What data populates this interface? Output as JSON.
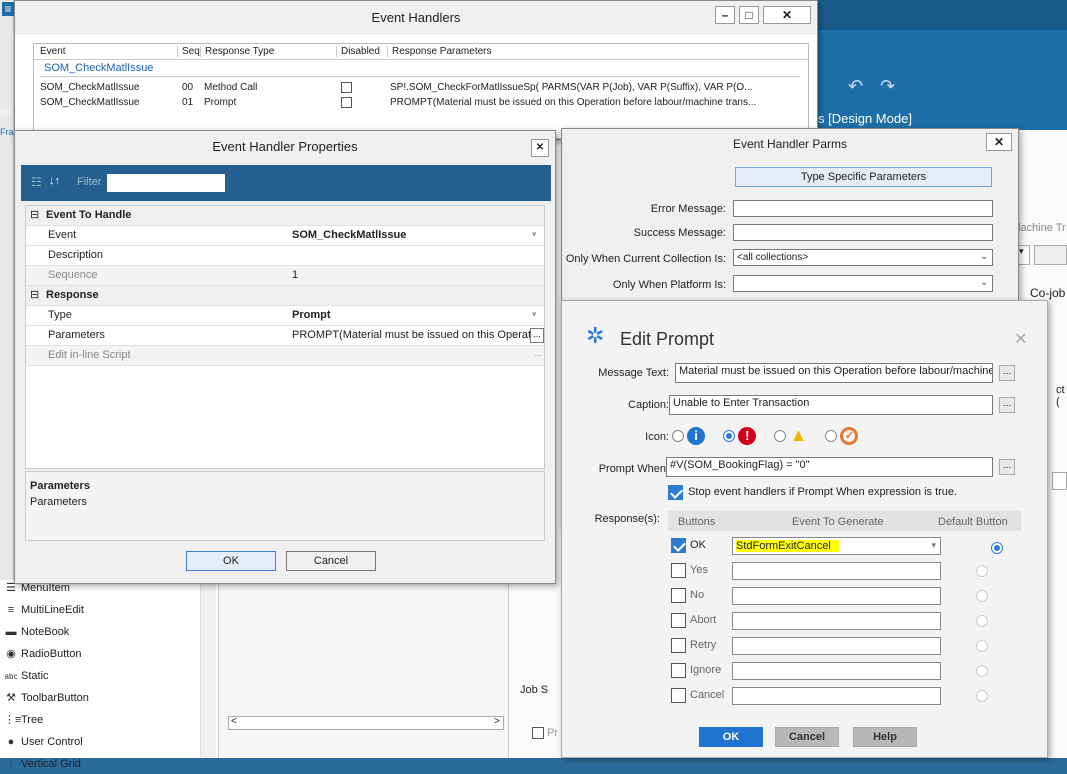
{
  "background": {
    "design_mode_label": "s  [Design Mode]",
    "right_labels": {
      "machine_tr": "lachine Tr",
      "co_job": "Co-job",
      "ct": "ct (",
      "job_s": "Job S",
      "pr": "Pr"
    },
    "toolbox_items": [
      {
        "label": "MenuItem",
        "icon": "menu-icon"
      },
      {
        "label": "MultiLineEdit",
        "icon": "multiline-icon"
      },
      {
        "label": "NoteBook",
        "icon": "notebook-icon"
      },
      {
        "label": "RadioButton",
        "icon": "radio-icon"
      },
      {
        "label": "Static",
        "icon": "abc-icon",
        "prefix": "abc"
      },
      {
        "label": "ToolbarButton",
        "icon": "toolbar-icon"
      },
      {
        "label": "Tree",
        "icon": "tree-icon"
      },
      {
        "label": "User Control",
        "icon": "user-icon"
      },
      {
        "label": "Vertical Grid",
        "icon": "grid-icon"
      }
    ],
    "left_strip_text": "Fra",
    "left_strip_text2": "oo"
  },
  "event_handlers": {
    "title": "Event Handlers",
    "columns": [
      "Event",
      "Seq",
      "Response Type",
      "Disabled",
      "Response Parameters"
    ],
    "group": "SOM_CheckMatlIssue",
    "rows": [
      {
        "event": "SOM_CheckMatlIssue",
        "seq": "00",
        "type": "Method Call",
        "disabled": false,
        "params": "SP!.SOM_CheckForMatlIssueSp( PARMS(VAR P(Job), VAR P(Suffix), VAR P(O..."
      },
      {
        "event": "SOM_CheckMatlIssue",
        "seq": "01",
        "type": "Prompt",
        "disabled": false,
        "params": "PROMPT(Material must be issued on this Operation before labour/machine trans..."
      }
    ]
  },
  "props": {
    "title": "Event Handler Properties",
    "filter_label": "Filter",
    "filter_value": "",
    "sections": {
      "event": "Event To Handle",
      "response": "Response"
    },
    "rows": {
      "event": {
        "k": "Event",
        "v": "SOM_CheckMatlIssue"
      },
      "description": {
        "k": "Description",
        "v": ""
      },
      "sequence": {
        "k": "Sequence",
        "v": "1"
      },
      "type": {
        "k": "Type",
        "v": "Prompt"
      },
      "parameters": {
        "k": "Parameters",
        "v": "PROMPT(Material must be issued on this Operati"
      },
      "script": {
        "k": "Edit in-line Script",
        "v": ""
      }
    },
    "desc_title": "Parameters",
    "desc_text": "Parameters",
    "ok": "OK",
    "cancel": "Cancel"
  },
  "parms": {
    "title": "Event Handler Parms",
    "type_specific": "Type Specific Parameters",
    "error_label": "Error Message:",
    "error_value": "",
    "success_label": "Success Message:",
    "success_value": "",
    "collection_label": "Only When Current Collection Is:",
    "collection_value": "<all collections>",
    "platform_label": "Only When Platform Is:",
    "platform_value": ""
  },
  "prompt": {
    "title": "Edit Prompt",
    "message_label": "Message Text:",
    "message_value": "Material must be issued on this Operation before labour/machine tr",
    "caption_label": "Caption:",
    "caption_value": "Unable to Enter Transaction",
    "icon_label": "Icon:",
    "when_label": "Prompt When:",
    "when_value": "#V(SOM_BookingFlag) = \"0\"",
    "stop_label": "Stop event handlers if Prompt When expression is true.",
    "responses_label": "Response(s):",
    "col_buttons": "Buttons",
    "col_event": "Event To Generate",
    "col_default": "Default Button",
    "responses": [
      {
        "button": "OK",
        "checked": true,
        "event": "StdFormExitCancel",
        "default": true
      },
      {
        "button": "Yes",
        "checked": false,
        "event": "",
        "default": false
      },
      {
        "button": "No",
        "checked": false,
        "event": "",
        "default": false
      },
      {
        "button": "Abort",
        "checked": false,
        "event": "",
        "default": false
      },
      {
        "button": "Retry",
        "checked": false,
        "event": "",
        "default": false
      },
      {
        "button": "Ignore",
        "checked": false,
        "event": "",
        "default": false
      },
      {
        "button": "Cancel",
        "checked": false,
        "event": "",
        "default": false
      }
    ],
    "ok": "OK",
    "cancel": "Cancel",
    "help": "Help",
    "accent": "#1f73d1"
  }
}
